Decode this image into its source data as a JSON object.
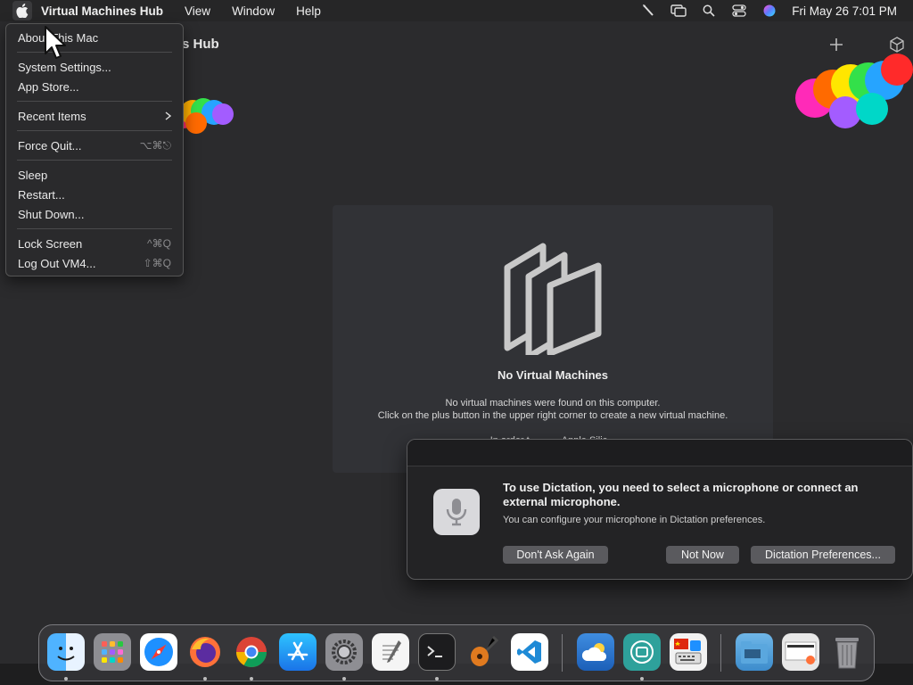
{
  "menubar": {
    "app_name": "Virtual Machines Hub",
    "menus": [
      "View",
      "Window",
      "Help"
    ],
    "clock": "Fri May 26  7:01 PM"
  },
  "window": {
    "title": "Virtual Machines Hub",
    "title_visible": "s Hub"
  },
  "empty_state": {
    "title": "No Virtual Machines",
    "line1": "No virtual machines were found on this computer.",
    "line2": "Click on the plus button in the upper right corner to create a new virtual machine.",
    "line3": "In order t... ... ... Apple Silic..."
  },
  "apple_menu": {
    "items": {
      "about": "About This Mac",
      "settings": "System Settings...",
      "appstore": "App Store...",
      "recent": "Recent Items",
      "forcequit": "Force Quit...",
      "forcequit_shortcut": "⌥⌘⎋",
      "sleep": "Sleep",
      "restart": "Restart...",
      "shutdown": "Shut Down...",
      "lock": "Lock Screen",
      "lock_shortcut": "^⌘Q",
      "logout": "Log Out VM4...",
      "logout_shortcut": "⇧⌘Q"
    }
  },
  "dialog": {
    "headline": "To use Dictation, you need to select a microphone or connect an external microphone.",
    "sub": "You can configure your microphone in Dictation preferences.",
    "btn_dont_ask": "Don't Ask Again",
    "btn_not_now": "Not Now",
    "btn_prefs": "Dictation Preferences..."
  },
  "dock": {
    "apps": [
      "finder-icon",
      "launchpad-icon",
      "safari-icon",
      "firefox-icon",
      "chrome-icon",
      "app-store-icon",
      "system-settings-icon",
      "textedit-icon",
      "terminal-icon",
      "garageband-icon",
      "vscode-icon",
      "weather-icon",
      "screen-sharing-icon",
      "input-keyboard-icon",
      "downloads-folder-icon",
      "documents-stack-icon",
      "trash-icon"
    ]
  },
  "colors": {
    "accent_text": "#f0f0f0",
    "dialog_button": "#5a5a5e"
  }
}
